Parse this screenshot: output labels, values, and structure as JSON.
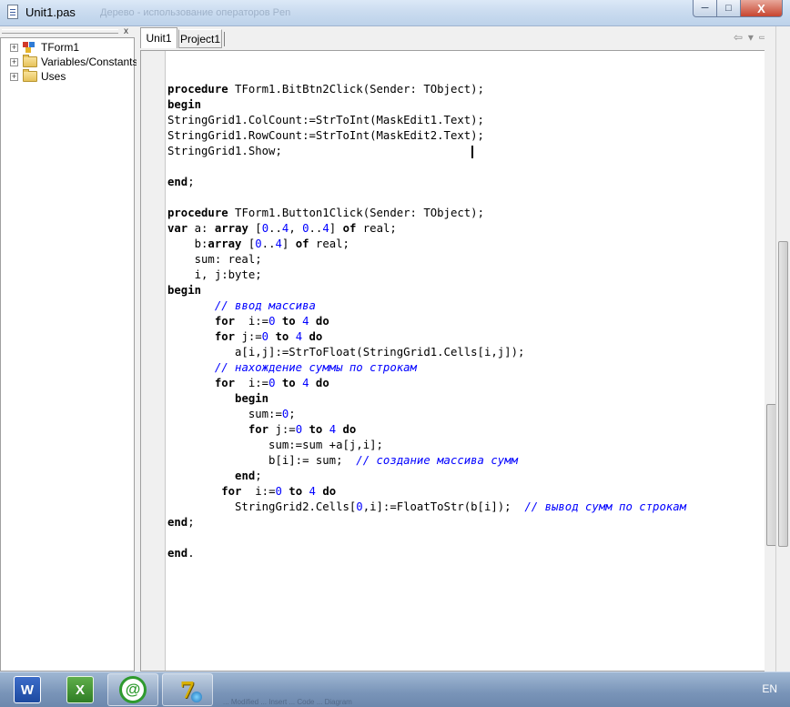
{
  "window": {
    "title": "Unit1.pas",
    "title_ghost": "Дерево - использование операторов Pen",
    "controls": {
      "minimize": "─",
      "maximize": "□",
      "close": "X"
    }
  },
  "explorer": {
    "close_glyph": "x",
    "items": [
      {
        "label": "TForm1",
        "icon": "form-icon"
      },
      {
        "label": "Variables/Constants",
        "icon": "folder-icon"
      },
      {
        "label": "Uses",
        "icon": "folder-icon"
      }
    ]
  },
  "tabs": [
    {
      "label": "Unit1",
      "active": true
    },
    {
      "label": "Project1",
      "active": false
    }
  ],
  "nav": {
    "back": "⇦",
    "back_drop": "▾",
    "forward": "⇨",
    "forward_drop": "▾"
  },
  "code_lines": [
    [],
    [
      {
        "t": "procedure",
        "c": "kw"
      },
      {
        "t": " TForm1.BitBtn2Click(Sender: TObject);"
      }
    ],
    [
      {
        "t": "begin",
        "c": "kw"
      }
    ],
    [
      {
        "t": "StringGrid1.ColCount:=StrToInt(MaskEdit1.Text);"
      }
    ],
    [
      {
        "t": "StringGrid1.RowCount:=StrToInt(MaskEdit2.Text);"
      }
    ],
    [
      {
        "t": "StringGrid1.Show;"
      }
    ],
    [],
    [
      {
        "t": "end",
        "c": "kw"
      },
      {
        "t": ";"
      }
    ],
    [],
    [
      {
        "t": "procedure",
        "c": "kw"
      },
      {
        "t": " TForm1.Button1Click(Sender: TObject);"
      }
    ],
    [
      {
        "t": "var",
        "c": "kw"
      },
      {
        "t": " a: "
      },
      {
        "t": "array",
        "c": "kw"
      },
      {
        "t": " ["
      },
      {
        "t": "0",
        "c": "num"
      },
      {
        "t": ".."
      },
      {
        "t": "4",
        "c": "num"
      },
      {
        "t": ", "
      },
      {
        "t": "0",
        "c": "num"
      },
      {
        "t": ".."
      },
      {
        "t": "4",
        "c": "num"
      },
      {
        "t": "] "
      },
      {
        "t": "of",
        "c": "kw"
      },
      {
        "t": " real;"
      }
    ],
    [
      {
        "t": "    b:"
      },
      {
        "t": "array",
        "c": "kw"
      },
      {
        "t": " ["
      },
      {
        "t": "0",
        "c": "num"
      },
      {
        "t": ".."
      },
      {
        "t": "4",
        "c": "num"
      },
      {
        "t": "] "
      },
      {
        "t": "of",
        "c": "kw"
      },
      {
        "t": " real;"
      }
    ],
    [
      {
        "t": "    sum: real;"
      }
    ],
    [
      {
        "t": "    i, j:byte;"
      }
    ],
    [
      {
        "t": "begin",
        "c": "kw"
      }
    ],
    [
      {
        "t": "       "
      },
      {
        "t": "// ввод массива",
        "c": "cm"
      }
    ],
    [
      {
        "t": "       "
      },
      {
        "t": "for",
        "c": "kw"
      },
      {
        "t": "  i:="
      },
      {
        "t": "0",
        "c": "num"
      },
      {
        "t": " "
      },
      {
        "t": "to",
        "c": "kw"
      },
      {
        "t": " "
      },
      {
        "t": "4",
        "c": "num"
      },
      {
        "t": " "
      },
      {
        "t": "do",
        "c": "kw"
      }
    ],
    [
      {
        "t": "       "
      },
      {
        "t": "for",
        "c": "kw"
      },
      {
        "t": " j:="
      },
      {
        "t": "0",
        "c": "num"
      },
      {
        "t": " "
      },
      {
        "t": "to",
        "c": "kw"
      },
      {
        "t": " "
      },
      {
        "t": "4",
        "c": "num"
      },
      {
        "t": " "
      },
      {
        "t": "do",
        "c": "kw"
      }
    ],
    [
      {
        "t": "          a[i,j]:=StrToFloat(StringGrid1.Cells[i,j]);"
      }
    ],
    [
      {
        "t": "       "
      },
      {
        "t": "// нахождение суммы по строкам",
        "c": "cm"
      }
    ],
    [
      {
        "t": "       "
      },
      {
        "t": "for",
        "c": "kw"
      },
      {
        "t": "  i:="
      },
      {
        "t": "0",
        "c": "num"
      },
      {
        "t": " "
      },
      {
        "t": "to",
        "c": "kw"
      },
      {
        "t": " "
      },
      {
        "t": "4",
        "c": "num"
      },
      {
        "t": " "
      },
      {
        "t": "do",
        "c": "kw"
      }
    ],
    [
      {
        "t": "          "
      },
      {
        "t": "begin",
        "c": "kw"
      }
    ],
    [
      {
        "t": "            sum:="
      },
      {
        "t": "0",
        "c": "num"
      },
      {
        "t": ";"
      }
    ],
    [
      {
        "t": "            "
      },
      {
        "t": "for",
        "c": "kw"
      },
      {
        "t": " j:="
      },
      {
        "t": "0",
        "c": "num"
      },
      {
        "t": " "
      },
      {
        "t": "to",
        "c": "kw"
      },
      {
        "t": " "
      },
      {
        "t": "4",
        "c": "num"
      },
      {
        "t": " "
      },
      {
        "t": "do",
        "c": "kw"
      }
    ],
    [
      {
        "t": "               sum:=sum +a[j,i];"
      }
    ],
    [
      {
        "t": "               b[i]:= sum;  "
      },
      {
        "t": "// создание массива сумм",
        "c": "cm"
      }
    ],
    [
      {
        "t": "          "
      },
      {
        "t": "end",
        "c": "kw"
      },
      {
        "t": ";"
      }
    ],
    [
      {
        "t": "        "
      },
      {
        "t": "for",
        "c": "kw"
      },
      {
        "t": "  i:="
      },
      {
        "t": "0",
        "c": "num"
      },
      {
        "t": " "
      },
      {
        "t": "to",
        "c": "kw"
      },
      {
        "t": " "
      },
      {
        "t": "4",
        "c": "num"
      },
      {
        "t": " "
      },
      {
        "t": "do",
        "c": "kw"
      }
    ],
    [
      {
        "t": "          StringGrid2.Cells["
      },
      {
        "t": "0",
        "c": "num"
      },
      {
        "t": ",i]:=FloatToStr(b[i]);  "
      },
      {
        "t": "// вывод сумм по строкам",
        "c": "cm"
      }
    ],
    [
      {
        "t": "end",
        "c": "kw"
      },
      {
        "t": ";"
      }
    ],
    [],
    [
      {
        "t": "end",
        "c": "kw"
      },
      {
        "t": "."
      }
    ]
  ],
  "taskbar": {
    "apps": [
      {
        "name": "word-icon",
        "glyph": "W"
      },
      {
        "name": "excel-icon",
        "glyph": "X"
      },
      {
        "name": "agent-icon",
        "glyph": "@"
      },
      {
        "name": "delphi-icon",
        "glyph": "7"
      }
    ],
    "ghost_text": "... Modified ... Insert ... Code ... Diagram",
    "language": "EN"
  },
  "colors": {
    "keyword": "#000000",
    "number": "#0000ff",
    "comment": "#0000ff",
    "titlebar": "#c9dbef"
  }
}
